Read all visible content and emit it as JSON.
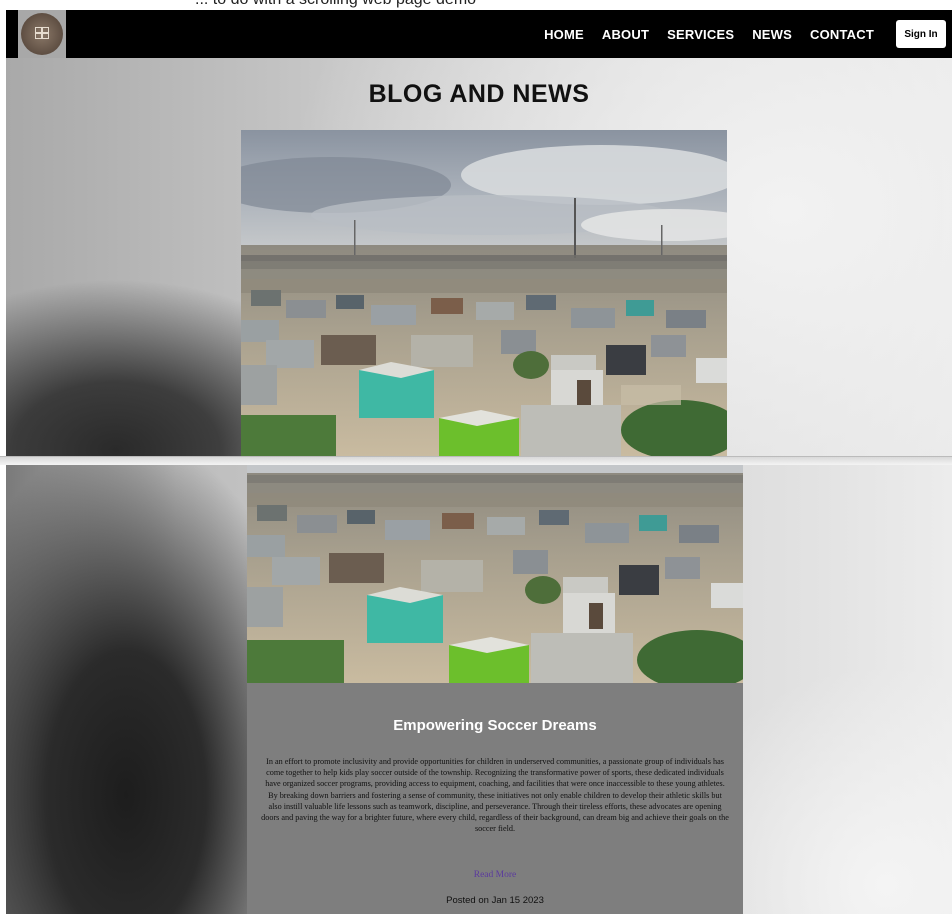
{
  "caption": "... to do with a scrolling web page demo",
  "nav": {
    "logo_alt": "logo",
    "links": [
      "HOME",
      "ABOUT",
      "SERVICES",
      "NEWS",
      "CONTACT"
    ],
    "signin_label": "Sign In"
  },
  "page": {
    "title": "BLOG AND NEWS"
  },
  "post": {
    "title": "Empowering Soccer Dreams",
    "body": "In an effort to promote inclusivity and provide opportunities for children in underserved communities, a passionate group of individuals has come together to help kids play soccer outside of the township. Recognizing the transformative power of sports, these dedicated individuals have organized soccer programs, providing access to equipment, coaching, and facilities that were once inaccessible to these young athletes. By breaking down barriers and fostering a sense of community, these initiatives not only enable children to develop their athletic skills but also instill valuable life lessons such as teamwork, discipline, and perseverance. Through their tireless efforts, these advocates are opening doors and paving the way for a brighter future, where every child, regardless of their background, can dream big and achieve their goals on the soccer field.",
    "read_more": "Read More",
    "posted": "Posted on Jan 15 2023"
  },
  "colors": {
    "navbar": "#000000",
    "post_card": "#7e7e7e",
    "link": "#5b3a9e"
  }
}
